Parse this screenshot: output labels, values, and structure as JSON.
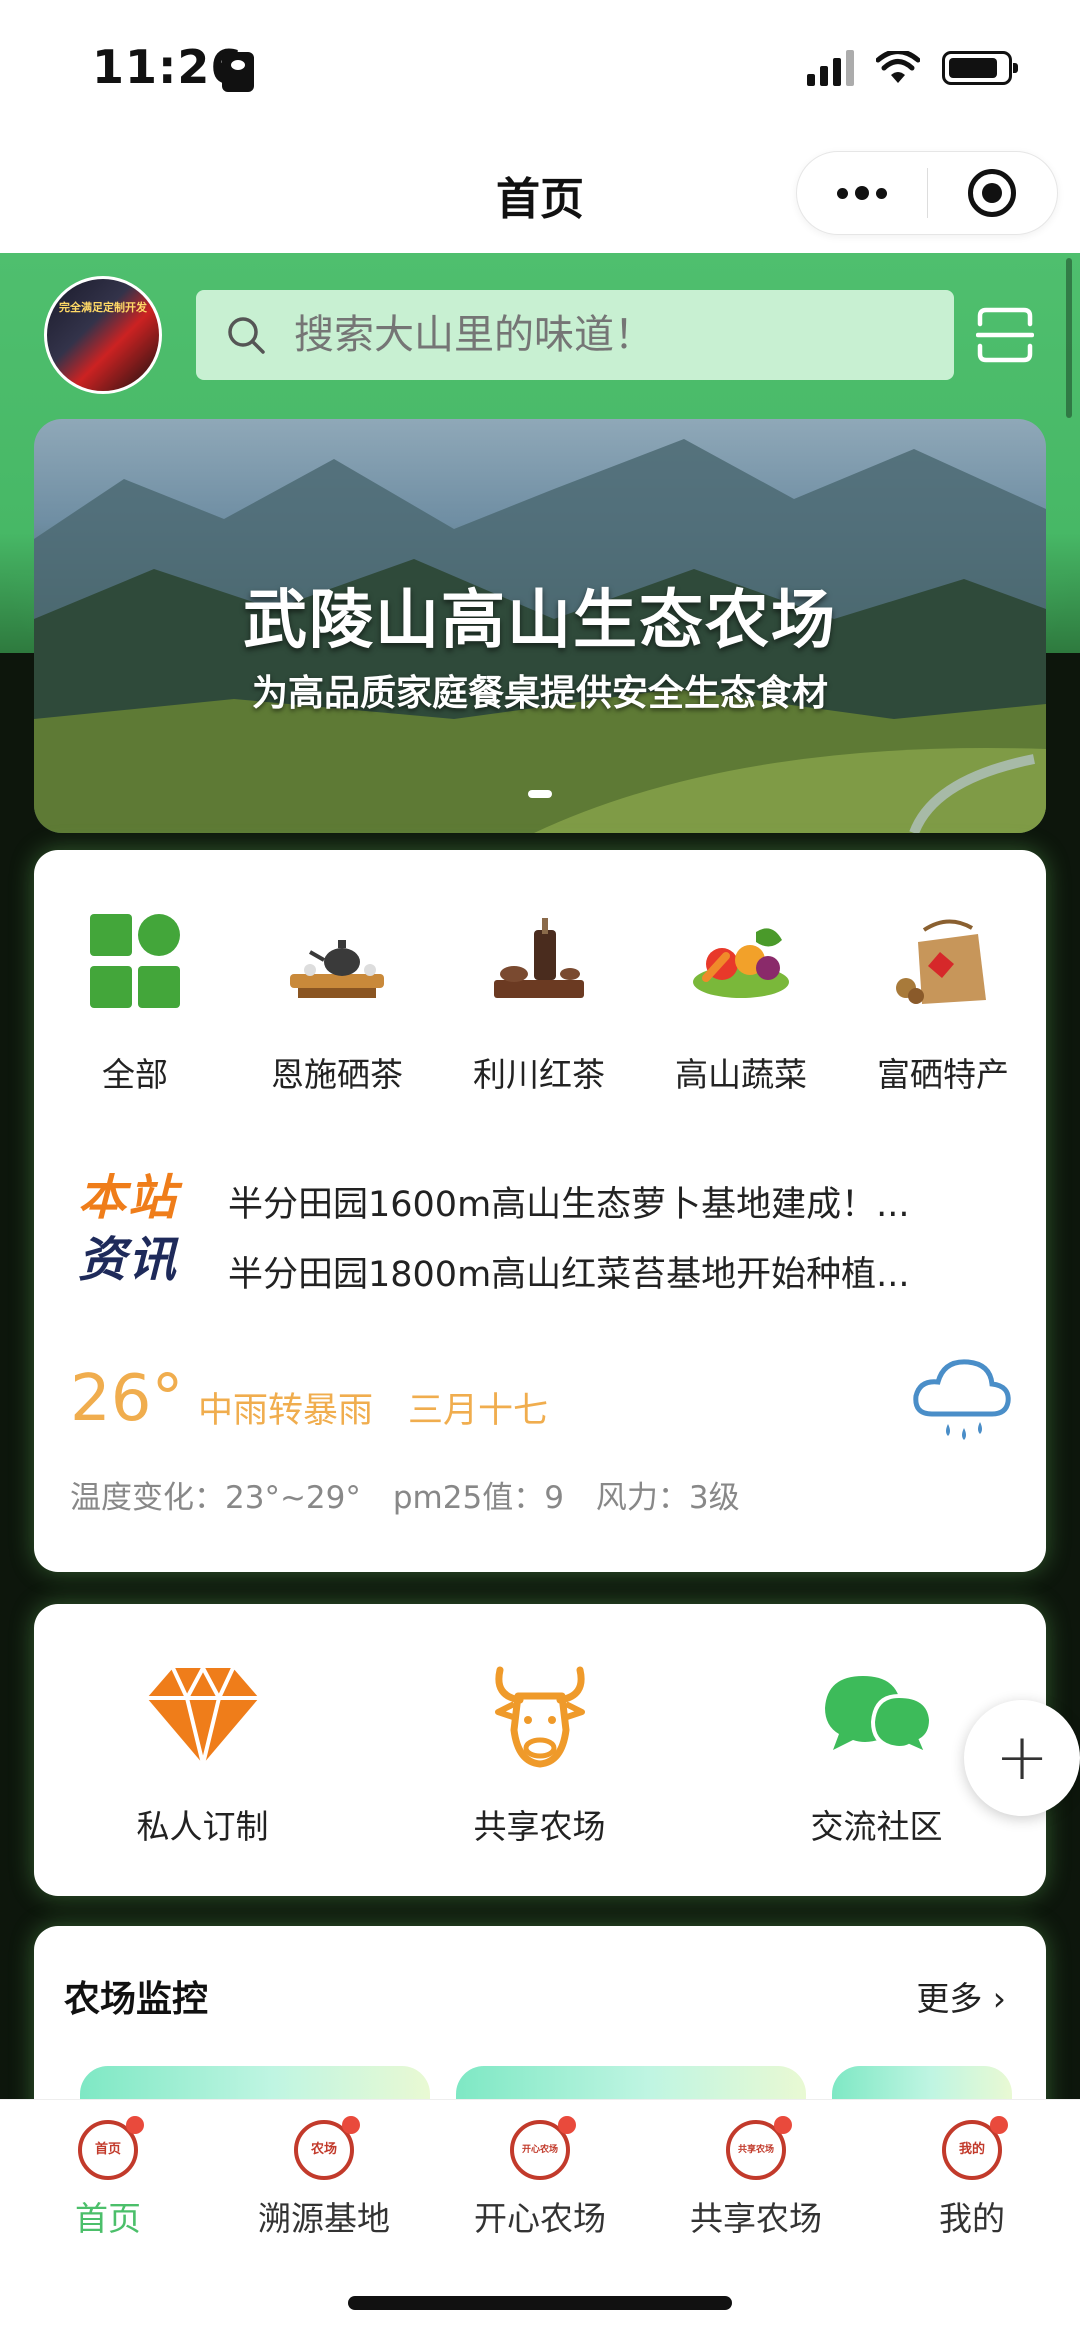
{
  "status_bar": {
    "time": "11:26"
  },
  "nav": {
    "title": "首页"
  },
  "header": {
    "avatar_text": "完全满足定制开发",
    "search_placeholder": "搜索大山里的味道！"
  },
  "banner": {
    "title": "武陵山高山生态农场",
    "subtitle": "为高品质家庭餐桌提供安全生态食材"
  },
  "categories": [
    {
      "label": "全部",
      "icon": "grid-icon"
    },
    {
      "label": "恩施硒茶",
      "icon": "tea-set-icon"
    },
    {
      "label": "利川红茶",
      "icon": "tea-pot-icon"
    },
    {
      "label": "高山蔬菜",
      "icon": "vegetables-icon"
    },
    {
      "label": "富硒特产",
      "icon": "gift-basket-icon"
    }
  ],
  "news": {
    "logo_line1": "本站",
    "logo_line2": "资讯",
    "items": [
      "半分田园1600m高山生态萝卜基地建成！...",
      "半分田园1800m高山红菜苔基地开始种植..."
    ]
  },
  "weather": {
    "temperature": "26°",
    "condition": "中雨转暴雨",
    "lunar_date": "三月十七",
    "temp_range": "温度变化：23°~29°",
    "pm25": "pm25值：9",
    "wind": "风力：3级",
    "icon": "rain-cloud-icon"
  },
  "quick_links": [
    {
      "label": "私人订制",
      "icon": "diamond-icon"
    },
    {
      "label": "共享农场",
      "icon": "ox-head-icon"
    },
    {
      "label": "交流社区",
      "icon": "chat-bubbles-icon"
    }
  ],
  "fab": {
    "label": "+"
  },
  "monitor": {
    "title": "农场监控",
    "more": "更多 ›"
  },
  "tabs": [
    {
      "label": "首页",
      "icon_text": "首页",
      "active": true
    },
    {
      "label": "溯源基地",
      "icon_text": "农场",
      "active": false
    },
    {
      "label": "开心农场",
      "icon_text": "开心农场",
      "active": false
    },
    {
      "label": "共享农场",
      "icon_text": "共享农场",
      "active": false
    },
    {
      "label": "我的",
      "icon_text": "我的",
      "active": false
    }
  ],
  "colors": {
    "brand_green": "#4bbf6a",
    "accent_orange": "#ef7d1a",
    "weather_orange": "#f0ad4e",
    "search_bg": "#c8f0d2"
  }
}
